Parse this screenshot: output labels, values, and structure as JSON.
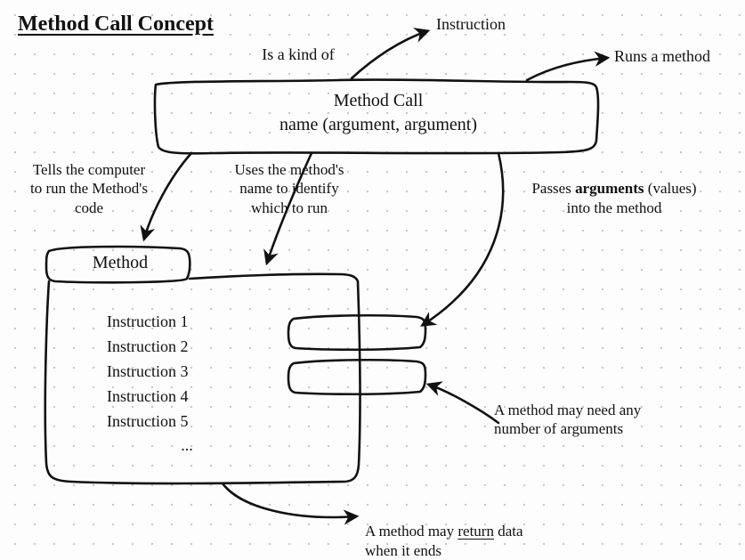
{
  "title": "Method Call Concept",
  "main_box": {
    "line1": "Method Call",
    "line2": "name (argument, argument)"
  },
  "rel_is_a_kind_of": "Is a kind of",
  "rel_instruction_target": "Instruction",
  "rel_runs_a_method": "Runs a method",
  "rel_tells_computer": "Tells the computer\nto run the Method's\ncode",
  "rel_uses_name": "Uses the method's\nname to identify\nwhich to run",
  "rel_passes_args_pre": "Passes ",
  "rel_passes_args_bold": "arguments",
  "rel_passes_args_post": " (values)\ninto the method",
  "method_label": "Method",
  "instructions": [
    "Instruction 1",
    "Instruction 2",
    "Instruction 3",
    "Instruction 4",
    "Instruction 5",
    "..."
  ],
  "note_any_args": "A method may need any\nnumber of arguments",
  "note_return_pre": "A method may ",
  "note_return_u": "return",
  "note_return_post": " data\nwhen it ends"
}
